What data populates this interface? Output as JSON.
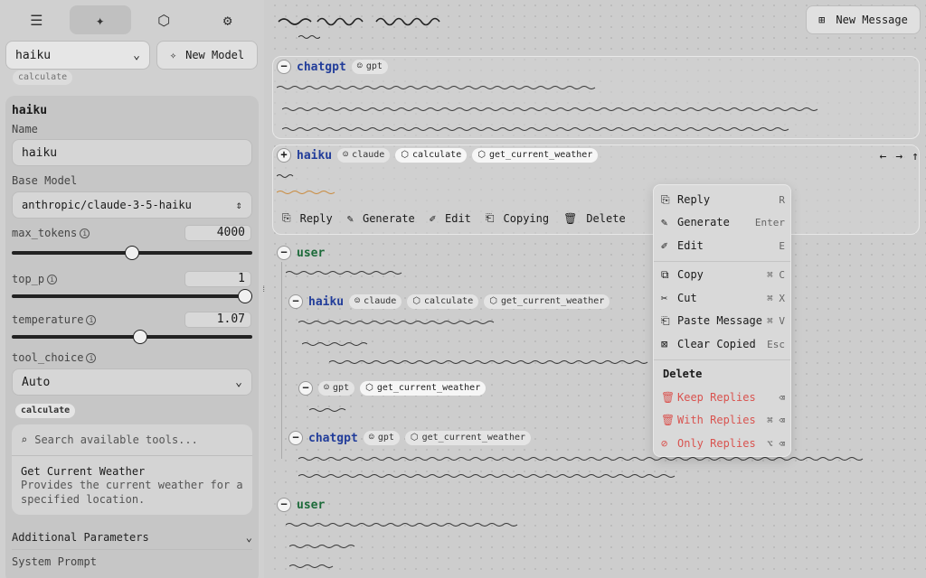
{
  "sidebar": {
    "tabs": [
      {
        "icon": "menu-icon",
        "glyph": "☰"
      },
      {
        "icon": "sparkle-icon",
        "glyph": "✦"
      },
      {
        "icon": "cube-icon",
        "glyph": "⬡"
      },
      {
        "icon": "gear-icon",
        "glyph": "⚙"
      }
    ],
    "model_select": "haiku",
    "new_model_label": "New Model",
    "faded_chip": "calculate",
    "panel": {
      "title": "haiku",
      "name_label": "Name",
      "name_value": "haiku",
      "base_model_label": "Base Model",
      "base_model_value": "anthropic/claude-3-5-haiku",
      "max_tokens_label": "max_tokens",
      "max_tokens_value": "4000",
      "max_tokens_fraction": 0.5,
      "top_p_label": "top_p",
      "top_p_value": "1",
      "top_p_fraction": 1.0,
      "temperature_label": "temperature",
      "temperature_value": "1.07",
      "temperature_fraction": 0.535,
      "tool_choice_label": "tool_choice",
      "tool_choice_value": "Auto",
      "tool_chip": "calculate",
      "tool_search_placeholder": "Search available tools...",
      "tool_name": "Get Current Weather",
      "tool_desc": "Provides the current weather for a specified location.",
      "additional_params": "Additional Parameters",
      "system_prompt": "System Prompt"
    }
  },
  "main": {
    "new_message_label": "New Message",
    "messages": [
      {
        "role": "chatgpt",
        "model_chip": "gpt"
      },
      {
        "role": "haiku",
        "model_chip": "claude",
        "tools": [
          "calculate",
          "get_current_weather"
        ]
      },
      {
        "role": "user"
      },
      {
        "role": "haiku",
        "model_chip": "claude",
        "tools": [
          "calculate",
          "get_current_weather"
        ]
      },
      {
        "role": "gpt_child",
        "model_chip": "gpt",
        "tools": [
          "get_current_weather"
        ]
      },
      {
        "role": "chatgpt",
        "model_chip": "gpt",
        "tools": [
          "get_current_weather"
        ]
      },
      {
        "role": "user"
      }
    ],
    "actions": [
      "Reply",
      "Generate",
      "Edit",
      "Copying",
      "Delete"
    ]
  },
  "context_menu": {
    "items": [
      {
        "label": "Reply",
        "shortcut": "R"
      },
      {
        "label": "Generate",
        "shortcut": "Enter"
      },
      {
        "label": "Edit",
        "shortcut": "E"
      },
      {
        "label": "Copy",
        "shortcut": "⌘ C"
      },
      {
        "label": "Cut",
        "shortcut": "⌘ X"
      },
      {
        "label": "Paste Message",
        "shortcut": "⌘ V"
      },
      {
        "label": "Clear Copied",
        "shortcut": "Esc"
      }
    ],
    "delete_heading": "Delete",
    "delete_items": [
      {
        "label": "Keep Replies",
        "shortcut": "⌫"
      },
      {
        "label": "With Replies",
        "shortcut": "⌘ ⌫"
      },
      {
        "label": "Only Replies",
        "shortcut": "⌥ ⌫"
      }
    ]
  },
  "colors": {
    "accent_blue": "#223d9a",
    "user_green": "#1d6b3a",
    "danger": "#d9534f"
  }
}
